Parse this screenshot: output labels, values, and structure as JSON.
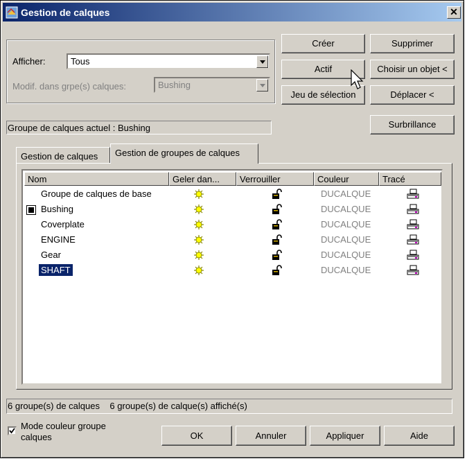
{
  "window": {
    "title": "Gestion de calques",
    "icon": "layers-app-icon",
    "close_label": "✕"
  },
  "filter": {
    "show_label": "Afficher:",
    "show_value": "Tous",
    "modif_label": "Modif. dans grpe(s) calques:",
    "modif_value": "Bushing"
  },
  "current_group": "Groupe de calques actuel : Bushing",
  "buttons": {
    "create": "Créer",
    "delete": "Supprimer",
    "active": "Actif",
    "choose_object": "Choisir un objet <",
    "selection_set": "Jeu de sélection",
    "move": "Déplacer <",
    "highlight": "Surbrillance",
    "ok": "OK",
    "cancel": "Annuler",
    "apply": "Appliquer",
    "help": "Aide"
  },
  "tabs": [
    {
      "label": "Gestion de calques"
    },
    {
      "label": "Gestion de groupes de calques"
    }
  ],
  "columns": [
    "Nom",
    "Geler dan...",
    "Verrouiller",
    "Couleur",
    "Tracé"
  ],
  "rows": [
    {
      "name": "Groupe de calques de base",
      "color": "DUCALQUE",
      "current": false,
      "selected": false
    },
    {
      "name": "Bushing",
      "color": "DUCALQUE",
      "current": true,
      "selected": false
    },
    {
      "name": "Coverplate",
      "color": "DUCALQUE",
      "current": false,
      "selected": false
    },
    {
      "name": "ENGINE",
      "color": "DUCALQUE",
      "current": false,
      "selected": false
    },
    {
      "name": "Gear",
      "color": "DUCALQUE",
      "current": false,
      "selected": false
    },
    {
      "name": "SHAFT",
      "color": "DUCALQUE",
      "current": false,
      "selected": true
    }
  ],
  "status": "6 groupe(s) de calques    6 groupe(s) de calque(s) affiché(s)",
  "color_mode": {
    "label_line1": "Mode couleur groupe",
    "label_line2": "calques",
    "checked": true
  },
  "colors": {
    "title_start": "#0a246a",
    "title_end": "#a6caf0",
    "selection": "#0a246a",
    "freeze_icon": "#ffff00",
    "face": "#d4d0c8"
  }
}
